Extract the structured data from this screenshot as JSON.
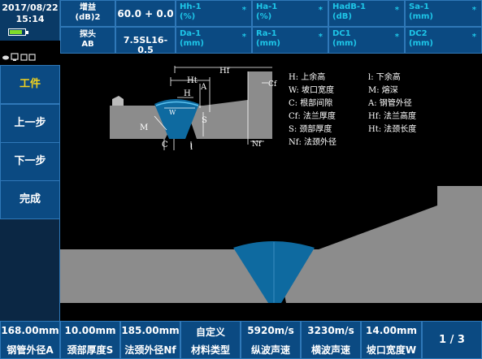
{
  "clock": {
    "date": "2017/08/22",
    "time": "15:14"
  },
  "header": {
    "gain_label": "增益",
    "gain_unit": "(dB)2",
    "gain_value": "60.0 + 0.0",
    "probe_label": "探头",
    "probe_sub": "AB",
    "probe_value": "7.5SL16-0.5",
    "measures": [
      {
        "label": "Hh-1",
        "unit": "(%)",
        "value": "*"
      },
      {
        "label": "Ha-1",
        "unit": "(%)",
        "value": "*"
      },
      {
        "label": "HadB-1",
        "unit": "(dB)",
        "value": "*"
      },
      {
        "label": "Sa-1",
        "unit": "(mm)",
        "value": "*"
      },
      {
        "label": "Da-1",
        "unit": "(mm)",
        "value": "*"
      },
      {
        "label": "Ra-1",
        "unit": "(mm)",
        "value": "*"
      },
      {
        "label": "DC1",
        "unit": "(mm)",
        "value": "*"
      },
      {
        "label": "DC2",
        "unit": "(mm)",
        "value": "*"
      }
    ]
  },
  "sidebar": [
    {
      "label": "工件",
      "active": true
    },
    {
      "label": "上一步",
      "active": false
    },
    {
      "label": "下一步",
      "active": false
    },
    {
      "label": "完成",
      "active": false
    }
  ],
  "diagram": {
    "labels": {
      "hf": "Hf",
      "ht": "Ht",
      "h": "H",
      "a": "A",
      "w": "W",
      "m": "M",
      "c": "C",
      "l": "l",
      "s": "S",
      "cf": "Cf",
      "nf": "Nf"
    },
    "legend": [
      "H: 上余高",
      "l: 下余高",
      "W: 坡口宽度",
      "M: 熔深",
      "C: 根部间隙",
      "A: 钢管外径",
      "Cf: 法兰厚度",
      "Hf: 法兰高度",
      "S: 颈部厚度",
      "Ht: 法颈长度",
      "Nf: 法颈外径"
    ]
  },
  "params": [
    {
      "value": "168.00mm",
      "label": "钢管外径A"
    },
    {
      "value": "10.00mm",
      "label": "颈部厚度S"
    },
    {
      "value": "185.00mm",
      "label": "法颈外径Nf"
    },
    {
      "value": "自定义",
      "label": "材料类型"
    },
    {
      "value": "5920m/s",
      "label": "纵波声速"
    },
    {
      "value": "3230m/s",
      "label": "横波声速"
    },
    {
      "value": "14.00mm",
      "label": "坡口宽度W"
    }
  ],
  "page": {
    "indicator": "1 / 3"
  },
  "colors": {
    "panel": "#0b4a82",
    "accent_text": "#1ec6e8",
    "active_text": "#f2d21e",
    "weld": "#0e6aa0",
    "metal": "#8c8c8c"
  }
}
